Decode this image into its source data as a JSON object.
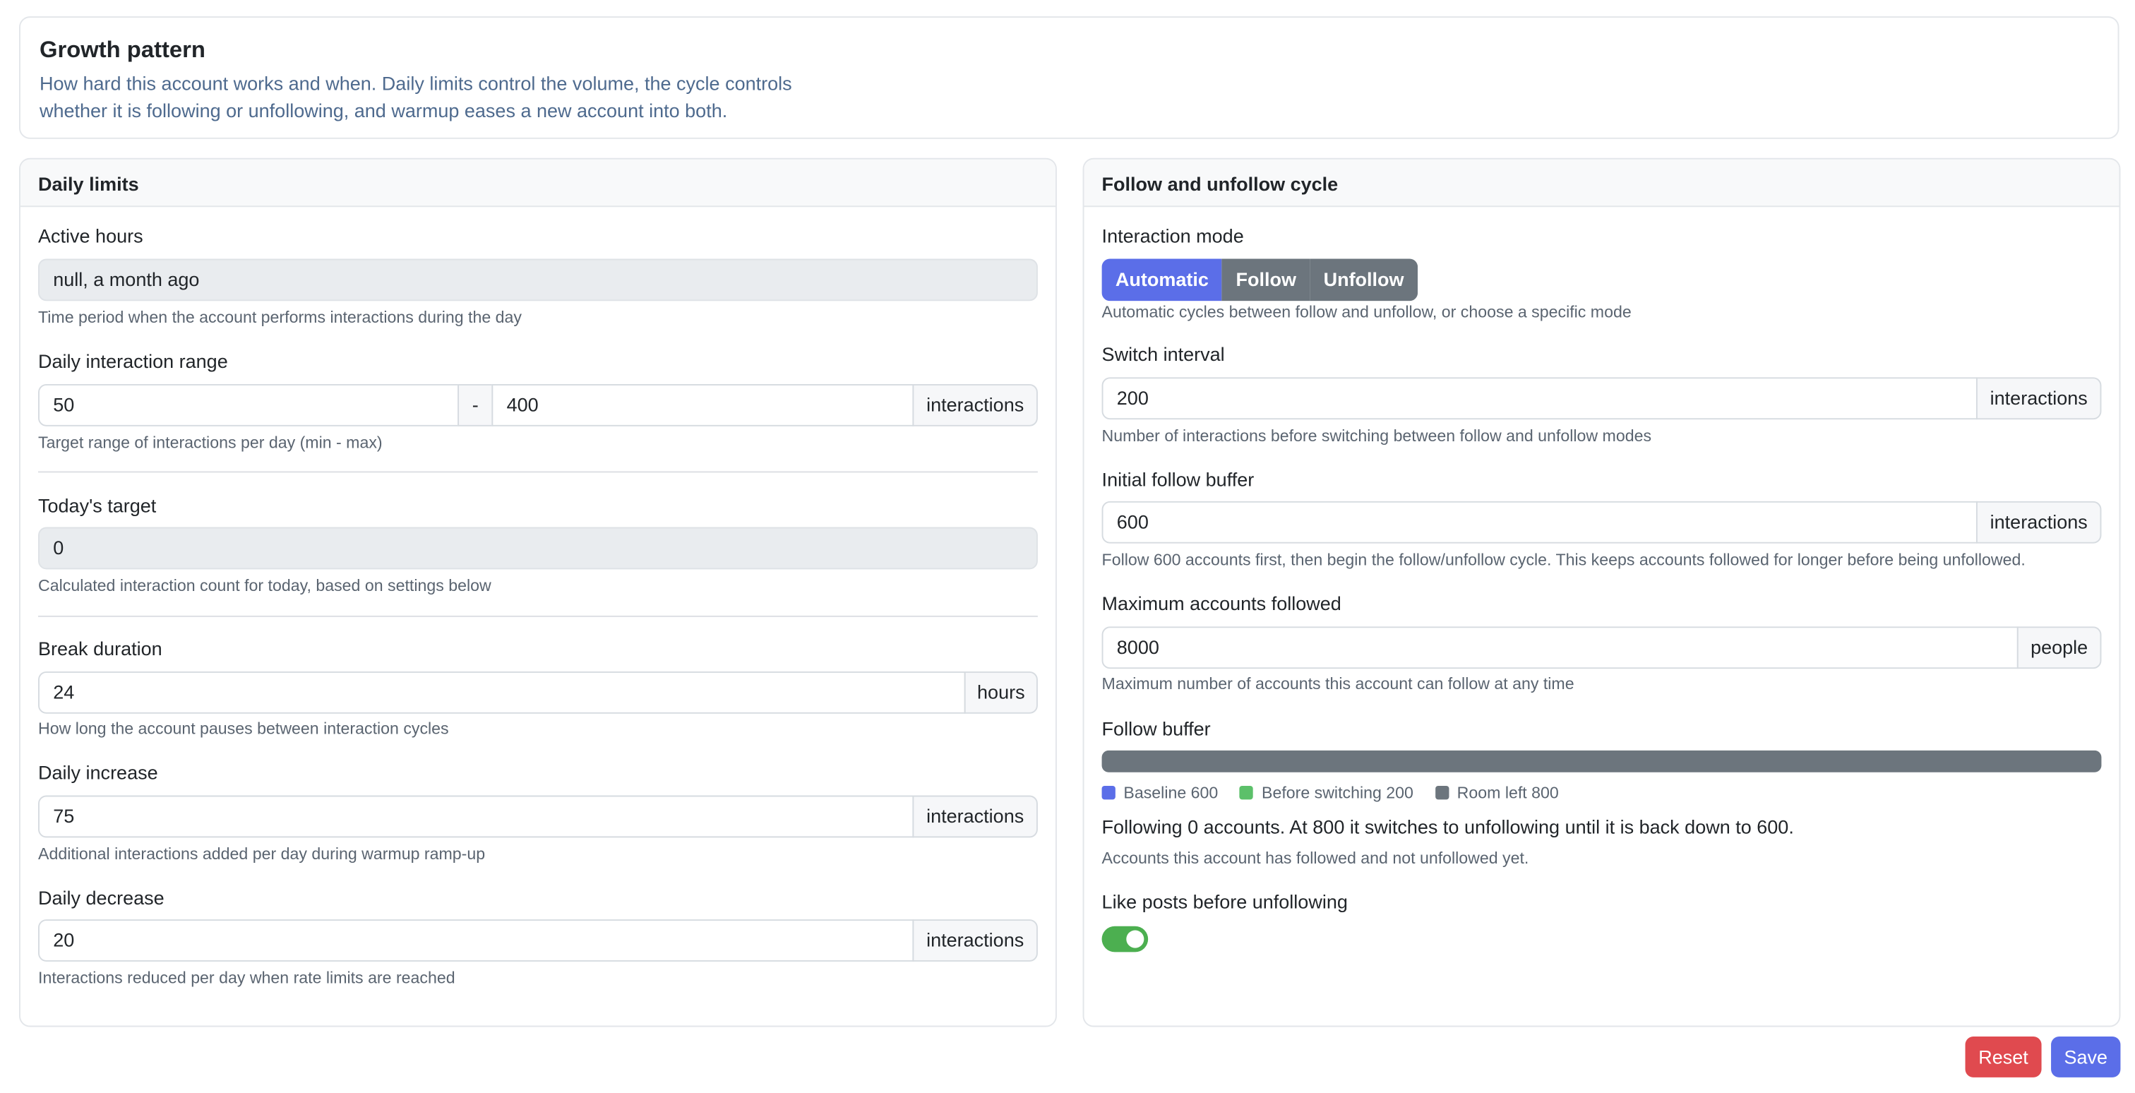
{
  "header": {
    "title": "Growth pattern",
    "description": "How hard this account works and when. Daily limits control the volume, the cycle controls whether it is following or unfollowing, and warmup eases a new account into both."
  },
  "left": {
    "title": "Daily limits",
    "active_hours": {
      "label": "Active hours",
      "value": "null, a month ago",
      "help": "Time period when the account performs interactions during the day"
    },
    "range": {
      "label": "Daily interaction range",
      "min": "50",
      "sep": "-",
      "max": "400",
      "unit": "interactions",
      "help": "Target range of interactions per day (min - max)"
    },
    "today": {
      "label": "Today's target",
      "value": "0",
      "help": "Calculated interaction count for today, based on settings below"
    },
    "break": {
      "label": "Break duration",
      "value": "24",
      "unit": "hours",
      "help": "How long the account pauses between interaction cycles"
    },
    "increase": {
      "label": "Daily increase",
      "value": "75",
      "unit": "interactions",
      "help": "Additional interactions added per day during warmup ramp-up"
    },
    "decrease": {
      "label": "Daily decrease",
      "value": "20",
      "unit": "interactions",
      "help": "Interactions reduced per day when rate limits are reached"
    }
  },
  "right": {
    "title": "Follow and unfollow cycle",
    "mode": {
      "label": "Interaction mode",
      "options": [
        "Automatic",
        "Follow",
        "Unfollow"
      ],
      "selected": "Automatic",
      "help": "Automatic cycles between follow and unfollow, or choose a specific mode"
    },
    "switch": {
      "label": "Switch interval",
      "value": "200",
      "unit": "interactions",
      "help": "Number of interactions before switching between follow and unfollow modes"
    },
    "initial": {
      "label": "Initial follow buffer",
      "value": "600",
      "unit": "interactions",
      "help": "Follow 600 accounts first, then begin the follow/unfollow cycle. This keeps accounts followed for longer before being unfollowed."
    },
    "max": {
      "label": "Maximum accounts followed",
      "value": "8000",
      "unit": "people",
      "help": "Maximum number of accounts this account can follow at any time"
    },
    "buffer": {
      "label": "Follow buffer",
      "legend": [
        {
          "name": "Baseline 600",
          "color": "#5b6ee8"
        },
        {
          "name": "Before switching 200",
          "color": "#5cc06a"
        },
        {
          "name": "Room left 800",
          "color": "#6c757d"
        }
      ],
      "status": "Following 0 accounts. At 800 it switches to unfollowing until it is back down to 600.",
      "help": "Accounts this account has followed and not unfollowed yet."
    },
    "like": {
      "label": "Like posts before unfollowing",
      "enabled": true
    }
  },
  "actions": {
    "reset": "Reset",
    "save": "Save"
  },
  "colors": {
    "primary": "#5b6ee8",
    "danger": "#e04a4f",
    "success": "#4caf50",
    "secondary": "#6c757d"
  }
}
